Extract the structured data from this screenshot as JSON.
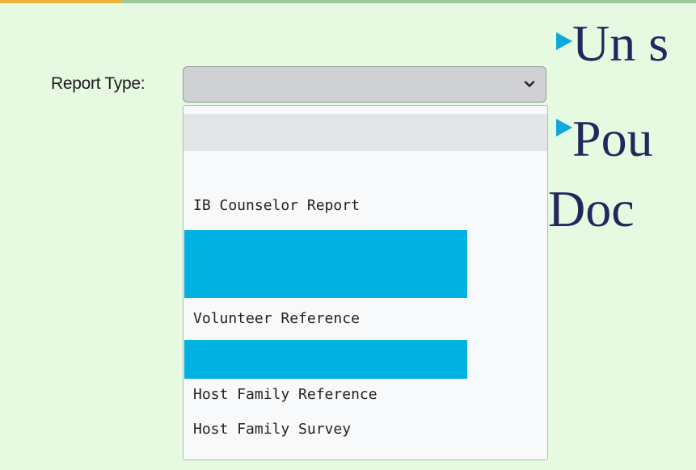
{
  "form": {
    "label": "Report Type:",
    "select_value": ""
  },
  "dropdown": {
    "options": [
      "",
      "IB Counselor Report",
      "Volunteer Reference",
      "Host Family Reference",
      "Host Family Survey"
    ],
    "redaction_color": "#00b1e1"
  },
  "slide": {
    "line1": "Un s",
    "line2": "Pou",
    "line3": "Doc",
    "text_color": "#1f2a5c",
    "bullet_color": "#0fa8dd"
  },
  "icons": {
    "select_arrow": "chevron-down-icon"
  }
}
